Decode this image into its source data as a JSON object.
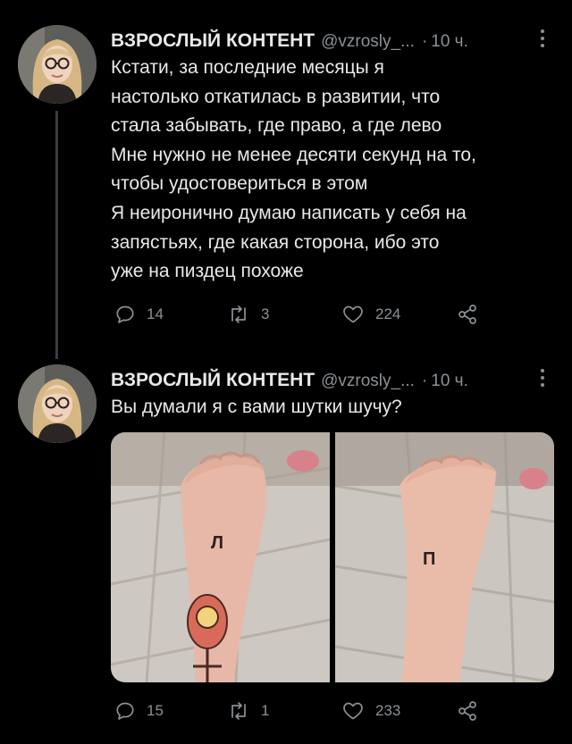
{
  "tweets": [
    {
      "author": "ВЗРОСЛЫЙ КОНТЕНТ",
      "handle": "@vzrosly_...",
      "time": "10 ч.",
      "lines": [
        "Кстати, за последние месяцы я",
        "настолько откатилась в развитии, что",
        "стала забывать, где право, а где лево",
        "Мне нужно не менее десяти секунд на то,",
        "чтобы удостовериться в этом",
        "Я неиронично думаю написать у себя на",
        "запястьях, где какая сторона, ибо это",
        "уже на пиздец похоже"
      ],
      "replies": "14",
      "retweets": "3",
      "likes": "224"
    },
    {
      "author": "ВЗРОСЛЫЙ КОНТЕНТ",
      "handle": "@vzrosly_...",
      "time": "10 ч.",
      "lines": [
        "Вы думали я с вами шутки шучу?"
      ],
      "replies": "15",
      "retweets": "1",
      "likes": "233",
      "media": {
        "left_wrist_mark": "Л",
        "right_wrist_mark": "П"
      }
    }
  ],
  "icons": {
    "reply": "reply-icon",
    "retweet": "retweet-icon",
    "like": "heart-icon",
    "share": "share-icon",
    "more": "more-icon"
  },
  "colors": {
    "background": "#000000",
    "text": "#e7e9ea",
    "muted": "#8b9196"
  }
}
